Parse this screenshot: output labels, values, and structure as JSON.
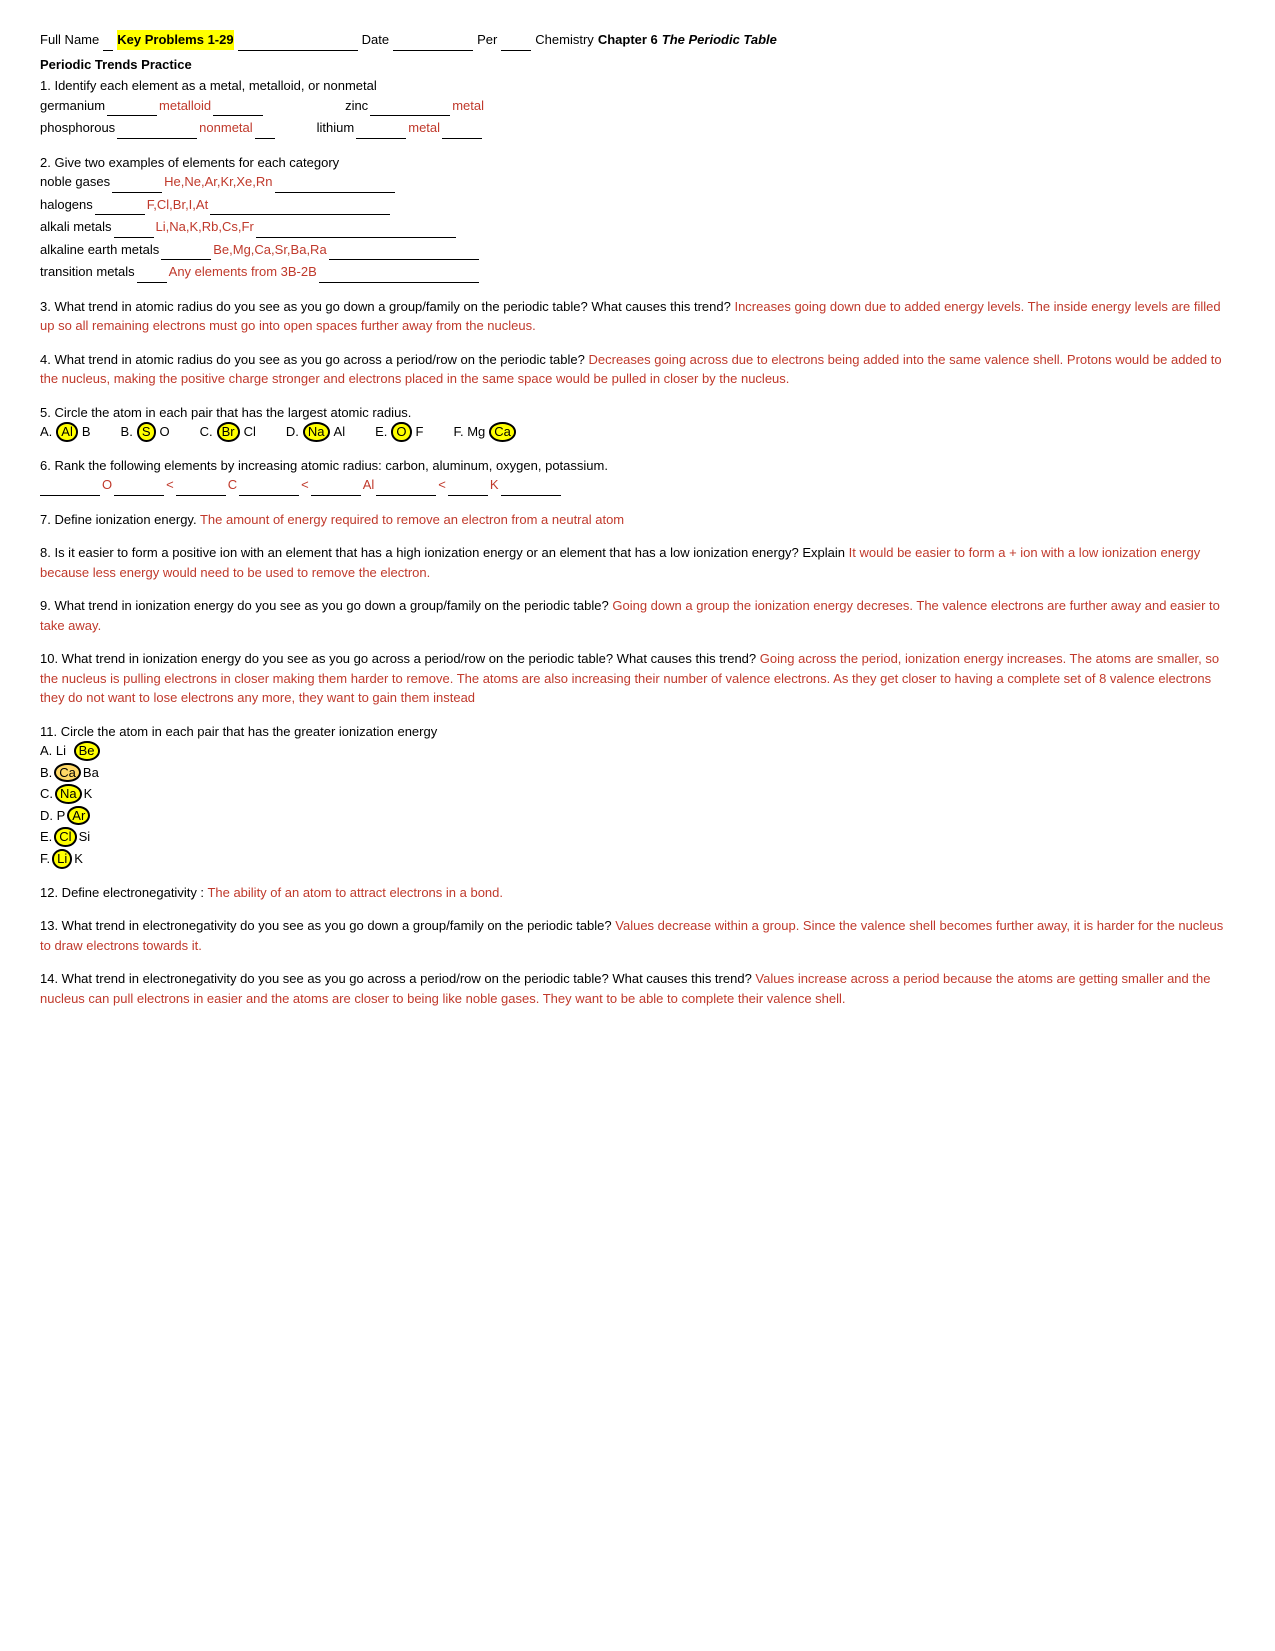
{
  "header": {
    "full_name_label": "Full Name",
    "name_value": "Key Problems 1-29",
    "date_label": "Date",
    "per_label": "Per",
    "chemistry_label": "Chemistry",
    "chapter_label": "Chapter 6",
    "chapter_title": "The Periodic Table"
  },
  "section_title": "Periodic Trends Practice",
  "q1": {
    "text": "1. Identify each element as a metal, metalloid, or nonmetal",
    "items": [
      {
        "element": "germanium",
        "blank_prefix": "",
        "answer": "metalloid",
        "blank_suffix": ""
      },
      {
        "element": "zinc",
        "blank_prefix": "",
        "answer": "metal",
        "blank_suffix": ""
      },
      {
        "element": "phosphorous",
        "blank_prefix": "",
        "answer": "nonmetal",
        "blank_suffix": ""
      },
      {
        "element": "lithium",
        "blank_prefix": "",
        "answer": "metal",
        "blank_suffix": ""
      }
    ]
  },
  "q2": {
    "text": "2. Give two examples of elements for each category",
    "items": [
      {
        "label": "noble gases",
        "answer": "He,Ne,Ar,Kr,Xe,Rn"
      },
      {
        "label": "halogens",
        "answer": "F,Cl,Br,I,At"
      },
      {
        "label": "alkali metals",
        "answer": "Li,Na,K,Rb,Cs,Fr"
      },
      {
        "label": "alkaline earth metals",
        "answer": "Be,Mg,Ca,Sr,Ba,Ra"
      },
      {
        "label": "transition metals",
        "answer": "Any elements from 3B-2B"
      }
    ]
  },
  "q3": {
    "question": "3. What trend in atomic radius do you see as you go down a group/family on the periodic table? What causes this trend?",
    "answer": "Increases going down due to added energy levels.  The inside energy levels are filled up so all remaining electrons must go into open spaces further away from the nucleus."
  },
  "q4": {
    "question": "4. What trend in atomic radius do you see as you go across a period/row on the periodic table?",
    "answer": "Decreases going across due to electrons being added into the same valence shell.  Protons would be added to the nucleus, making the positive charge stronger and electrons placed in the same space would be pulled in closer by the nucleus."
  },
  "q5": {
    "text": "5. Circle the atom in each pair that has the largest atomic radius.",
    "pairs": [
      {
        "label": "A.",
        "left": "Al",
        "right": "B",
        "circled": "left"
      },
      {
        "label": "B.",
        "left": "S",
        "right": "O",
        "circled": "left"
      },
      {
        "label": "C.",
        "left": "Br",
        "right": "Cl",
        "circled": "left"
      },
      {
        "label": "D.",
        "left": "Na",
        "right": "Al",
        "circled": "left"
      },
      {
        "label": "E.",
        "left": "O",
        "right": "F",
        "circled": "left"
      },
      {
        "label": "F.",
        "left": "Mg",
        "right": "Ca",
        "circled": "right"
      }
    ]
  },
  "q6": {
    "text": "6. Rank the following elements by increasing atomic radius: carbon, aluminum, oxygen, potassium.",
    "rank": "O < C < Al < K"
  },
  "q7": {
    "question": "7. Define ionization energy.",
    "answer": "The amount of energy required to remove an electron from a neutral atom"
  },
  "q8": {
    "question": "8. Is it easier to form a positive ion with an element that has a high ionization energy or an element that has a low ionization energy? Explain",
    "answer": "It would be easier to form a + ion with a low ionization energy because less energy would need to be used to remove the electron."
  },
  "q9": {
    "question": "9. What trend in ionization energy do you see as you go down a group/family on the periodic table?",
    "answer": "Going down a group the ionization energy decreses.  The valence electrons are further away and easier to take away."
  },
  "q10": {
    "question": "10. What trend in ionization energy do you see as you go across a period/row on the periodic table? What causes this trend?",
    "answer": "Going across the period, ionization energy increases.  The atoms are smaller, so the nucleus is pulling electrons in closer making them harder to remove.  The atoms are also increasing their number of valence electrons.  As they get closer to having a complete set of 8 valence electrons they do not want to lose electrons any more, they want to gain them instead"
  },
  "q11": {
    "text": "11. Circle the atom in each pair that has the greater ionization energy",
    "pairs": [
      {
        "label": "A.",
        "left": "Li",
        "right": "Be",
        "circled": "right"
      },
      {
        "label": "B.",
        "left": "Ca",
        "right": "Ba",
        "circled": "left"
      },
      {
        "label": "C.",
        "left": "Na",
        "right": "K",
        "circled": "left"
      },
      {
        "label": "D.",
        "left": "P",
        "right": "Ar",
        "circled": "right"
      },
      {
        "label": "E.",
        "left": "Cl",
        "right": "Si",
        "circled": "left"
      },
      {
        "label": "F.",
        "left": "Li",
        "right": "K",
        "circled": "left"
      }
    ]
  },
  "q12": {
    "question": "12. Define electronegativity :",
    "answer": "The ability of an atom to attract electrons in a bond."
  },
  "q13": {
    "question": "13. What trend in electronegativity do you see as you go down a group/family on the periodic table?",
    "answer": "Values decrease within a group.  Since the valence shell becomes further away, it is harder for the nucleus to draw electrons towards it."
  },
  "q14": {
    "question": "14. What trend in electronegativity do you see as you go across a period/row on the periodic table? What causes this trend?",
    "answer": "Values increase across a period because the atoms are getting smaller and the nucleus can pull electrons in easier and the atoms are closer to being like noble gases.  They want to be able to complete their valence shell."
  }
}
